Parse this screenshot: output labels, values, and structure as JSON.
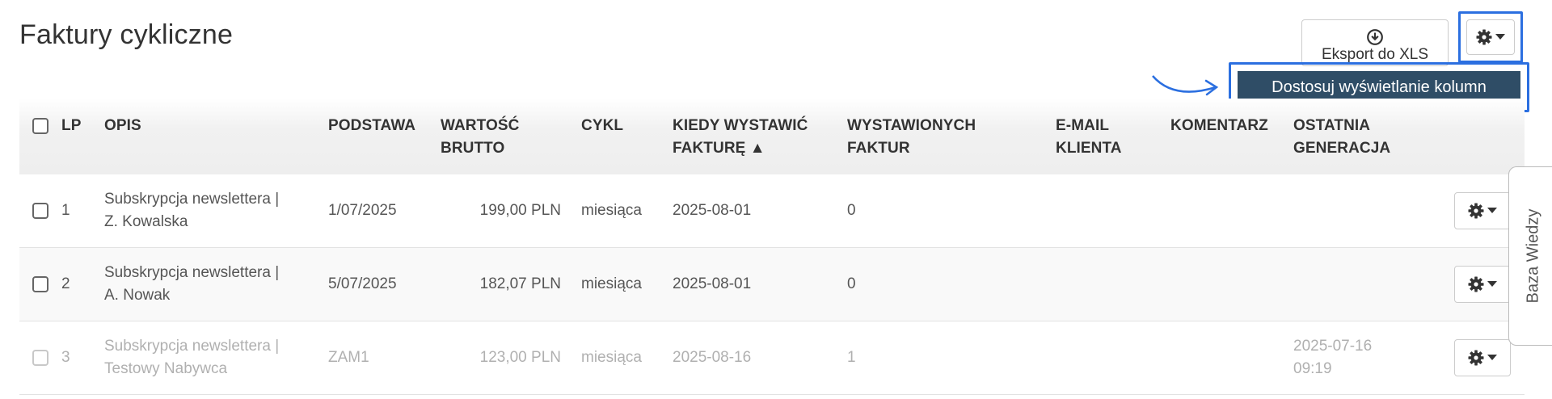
{
  "page": {
    "title": "Faktury cykliczne"
  },
  "toolbar": {
    "export_label": "Eksport do XLS",
    "dropdown_item": "Dostosuj wyświetlanie kolumn"
  },
  "table": {
    "headers": {
      "lp": "LP",
      "opis": "OPIS",
      "podstawa": "PODSTAWA",
      "wartosc_1": "WARTOŚĆ",
      "wartosc_2": "BRUTTO",
      "cykl": "CYKL",
      "kiedy_1": "KIEDY WYSTAWIĆ",
      "kiedy_2": "FAKTURĘ ▲",
      "wystawionych_1": "WYSTAWIONYCH",
      "wystawionych_2": "FAKTUR",
      "email_1": "E-MAIL",
      "email_2": "KLIENTA",
      "komentarz": "KOMENTARZ",
      "ostatnia_1": "OSTATNIA",
      "ostatnia_2": "GENERACJA"
    },
    "rows": [
      {
        "lp": "1",
        "opis_1": "Subskrypcja newslettera |",
        "opis_2": "Z. Kowalska",
        "podstawa": "1/07/2025",
        "wartosc": "199,00 PLN",
        "cykl": "miesiąca",
        "kiedy": "2025-08-01",
        "wystawionych": "0",
        "email": "",
        "komentarz": "",
        "ostatnia_1": "",
        "ostatnia_2": ""
      },
      {
        "lp": "2",
        "opis_1": "Subskrypcja newslettera |",
        "opis_2": "A. Nowak",
        "podstawa": "5/07/2025",
        "wartosc": "182,07 PLN",
        "cykl": "miesiąca",
        "kiedy": "2025-08-01",
        "wystawionych": "0",
        "email": "",
        "komentarz": "",
        "ostatnia_1": "",
        "ostatnia_2": ""
      },
      {
        "lp": "3",
        "opis_1": "Subskrypcja newslettera |",
        "opis_2": "Testowy Nabywca",
        "podstawa": "ZAM1",
        "wartosc": "123,00 PLN",
        "cykl": "miesiąca",
        "kiedy": "2025-08-16",
        "wystawionych": "1",
        "email": "",
        "komentarz": "",
        "ostatnia_1": "2025-07-16",
        "ostatnia_2": "09:19"
      }
    ]
  },
  "side_tab": {
    "label": "Baza Wiedzy"
  },
  "icons": {
    "export": "download-circle-icon",
    "gear": "gear-icon",
    "caret": "caret-down-icon",
    "annotation": "curved-arrow-icon"
  },
  "colors": {
    "accent_highlight": "#2b6fe0",
    "dropdown_bg": "#2f4d66",
    "header_bg": "#eeeeee",
    "muted_text": "#b0b0b0"
  }
}
